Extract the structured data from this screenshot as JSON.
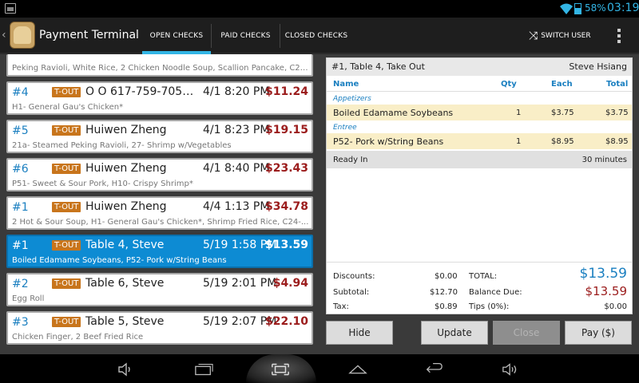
{
  "status": {
    "battery": "58%",
    "time": "03:19"
  },
  "app": {
    "title": "Payment Terminal"
  },
  "tabs": [
    "OPEN CHECKS",
    "PAID CHECKS",
    "CLOSED CHECKS"
  ],
  "actions": {
    "switch_user": "SWITCH USER"
  },
  "tout_label": "T-OUT",
  "checks": [
    {
      "num": "",
      "name": "",
      "date": "",
      "amount": "",
      "items": "Peking Ravioli, White Rice, 2 Chicken Noodle Soup, Scallion Pancake, C25..."
    },
    {
      "num": "#4",
      "name": "O O 617-759-7058,...",
      "date": "4/1 8:20 PM",
      "amount": "$11.24",
      "items": "H1- General Gau's Chicken*"
    },
    {
      "num": "#5",
      "name": "Huiwen Zheng",
      "date": "4/1 8:23 PM",
      "amount": "$19.15",
      "items": "21a- Steamed Peking Ravioli, 27- Shrimp w/Vegetables"
    },
    {
      "num": "#6",
      "name": "Huiwen Zheng",
      "date": "4/1 8:40 PM",
      "amount": "$23.43",
      "items": "P51- Sweet & Sour Pork, H10- Crispy Shrimp*"
    },
    {
      "num": "#1",
      "name": "Huiwen Zheng",
      "date": "4/4 1:13 PM",
      "amount": "$34.78",
      "items": "2 Hot & Sour Soup, H1- General Gau's Chicken*, Shrimp Fried Rice, C24-..."
    },
    {
      "num": "#1",
      "name": "Table 4, Steve",
      "date": "5/19 1:58 PM",
      "amount": "$13.59",
      "items": "Boiled Edamame Soybeans, P52- Pork w/String Beans"
    },
    {
      "num": "#2",
      "name": "Table 6, Steve",
      "date": "5/19 2:01 PM",
      "amount": "$4.94",
      "items": "Egg Roll"
    },
    {
      "num": "#3",
      "name": "Table 5, Steve",
      "date": "5/19 2:07 PM",
      "amount": "$22.10",
      "items": "Chicken Finger, 2 Beef Fried Rice"
    }
  ],
  "ticket": {
    "header": "#1, Table 4, Take Out",
    "server": "Steve Hsiang",
    "cols": {
      "name": "Name",
      "qty": "Qty",
      "each": "Each",
      "total": "Total"
    },
    "categories": [
      {
        "label": "Appetizers",
        "item": {
          "name": "Boiled Edamame Soybeans",
          "qty": "1",
          "each": "$3.75",
          "total": "$3.75"
        }
      },
      {
        "label": "Entree",
        "item": {
          "name": "P52- Pork w/String Beans",
          "qty": "1",
          "each": "$8.95",
          "total": "$8.95"
        }
      }
    ],
    "ready": {
      "label": "Ready In",
      "value": "30 minutes"
    },
    "totals": {
      "discounts_label": "Discounts:",
      "discounts": "$0.00",
      "subtotal_label": "Subtotal:",
      "subtotal": "$12.70",
      "tax_label": "Tax:",
      "tax": "$0.89",
      "total_label": "TOTAL:",
      "total": "$13.59",
      "due_label": "Balance Due:",
      "due": "$13.59",
      "tips_label": "Tips (0%):",
      "tips": "$0.00"
    }
  },
  "buttons": {
    "hide": "Hide",
    "update": "Update",
    "close": "Close",
    "pay": "Pay ($)"
  }
}
